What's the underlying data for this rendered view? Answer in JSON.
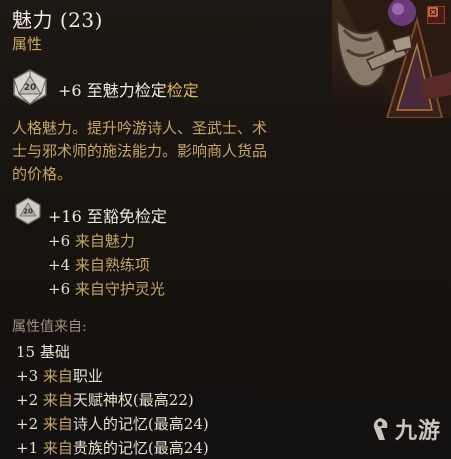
{
  "tooltip": {
    "title": "魅力 (23)",
    "subtitle": "属性"
  },
  "roll": {
    "die_value": "20",
    "modifier": "+6",
    "check_prefix": "至魅力检定",
    "check_suffix": "检定",
    "check_text": "至魅力检定"
  },
  "description": {
    "lines": [
      "人格魅力。提升吟游诗人、圣武士、术",
      "士与邪术师的施法能力。影响商人货品",
      "的价格。"
    ]
  },
  "save": {
    "die_value": "20",
    "modifier": "+16",
    "text": "至豁免检定",
    "sources": [
      {
        "value": "+6",
        "from": "来自",
        "name": "魅力"
      },
      {
        "value": "+4",
        "from": "来自",
        "name": "熟练项"
      },
      {
        "value": "+6",
        "from": "来自",
        "name": "守护灵光"
      }
    ]
  },
  "breakdown": {
    "label": "属性值来自:",
    "rows": [
      {
        "value": "15",
        "from": "",
        "name": "基础"
      },
      {
        "value": "+3",
        "from": "来自",
        "name": "职业"
      },
      {
        "value": "+2",
        "from": "来自",
        "name": "天赋神权(最高22)"
      },
      {
        "value": "+2",
        "from": "来自",
        "name": "诗人的记忆(最高24)"
      },
      {
        "value": "+1",
        "from": "来自",
        "name": "贵族的记忆(最高24)"
      }
    ]
  },
  "watermark": {
    "text": "九游"
  },
  "colors": {
    "accent_gold": "#c4a46a",
    "text_light": "#e8dfd0",
    "background": "#17130f"
  },
  "icons": [
    "d20-die-icon",
    "d20-die-small-icon",
    "corner-badge-icon",
    "watermark-logo-icon"
  ]
}
